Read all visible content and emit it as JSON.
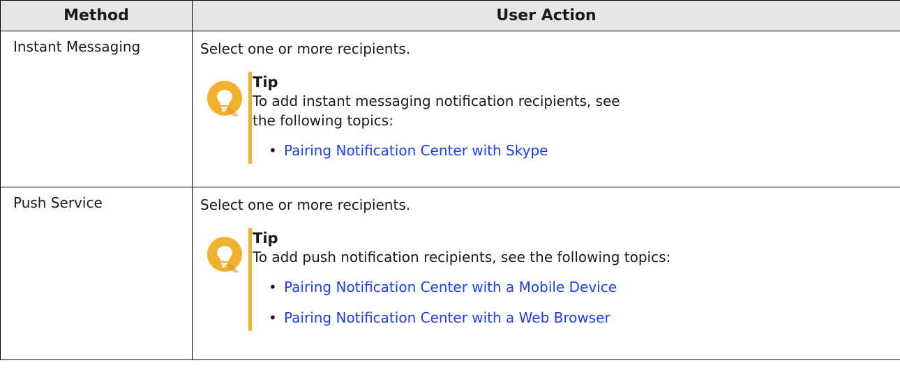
{
  "table": {
    "headers": {
      "method": "Method",
      "user_action": "User Action"
    },
    "rows": [
      {
        "method": "Instant Messaging",
        "action": "Select one or more recipients.",
        "tip": {
          "title": "Tip",
          "body": "To add instant messaging notification recipients, see the following topics:",
          "links": [
            "Pairing Notification Center with Skype"
          ]
        }
      },
      {
        "method": "Push Service",
        "action": "Select one or more recipients.",
        "tip": {
          "title": "Tip",
          "body": "To add push notification recipients, see the following topics:",
          "links": [
            "Pairing Notification Center with a Mobile Device",
            "Pairing Notification Center with a Web Browser"
          ]
        }
      }
    ]
  },
  "colors": {
    "header_bg": "#e6e6e6",
    "tip_accent": "#f2b12d",
    "link": "#1a3ef0"
  },
  "icons": {
    "tip": "lightbulb-icon"
  }
}
